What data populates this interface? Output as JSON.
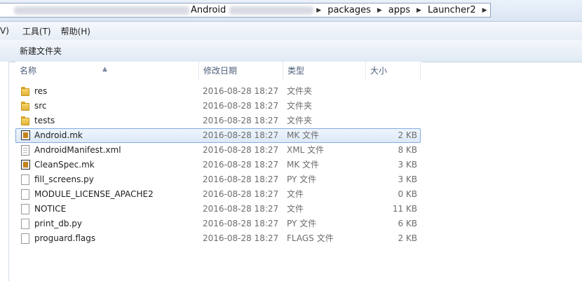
{
  "addressbar": {
    "crumbs": [
      "Android",
      "packages",
      "apps",
      "Launcher2"
    ]
  },
  "menubar": {
    "items": [
      "V)",
      "工具(T)",
      "帮助(H)"
    ]
  },
  "toolbar": {
    "new_folder_label": "新建文件夹"
  },
  "columns": {
    "name": "名称",
    "date": "修改日期",
    "type": "类型",
    "size": "大小"
  },
  "files": [
    {
      "name": "res",
      "date": "2016-08-28 18:27",
      "type": "文件夹",
      "size": "",
      "icon": "folder-icon"
    },
    {
      "name": "src",
      "date": "2016-08-28 18:27",
      "type": "文件夹",
      "size": "",
      "icon": "folder-icon"
    },
    {
      "name": "tests",
      "date": "2016-08-28 18:27",
      "type": "文件夹",
      "size": "",
      "icon": "folder-icon"
    },
    {
      "name": "Android.mk",
      "date": "2016-08-28 18:27",
      "type": "MK 文件",
      "size": "2 KB",
      "icon": "mk-file-icon",
      "selected": true
    },
    {
      "name": "AndroidManifest.xml",
      "date": "2016-08-28 18:27",
      "type": "XML 文件",
      "size": "8 KB",
      "icon": "document-icon"
    },
    {
      "name": "CleanSpec.mk",
      "date": "2016-08-28 18:27",
      "type": "MK 文件",
      "size": "3 KB",
      "icon": "mk-file-icon"
    },
    {
      "name": "fill_screens.py",
      "date": "2016-08-28 18:27",
      "type": "PY 文件",
      "size": "3 KB",
      "icon": "blank-file-icon"
    },
    {
      "name": "MODULE_LICENSE_APACHE2",
      "date": "2016-08-28 18:27",
      "type": "文件",
      "size": "0 KB",
      "icon": "blank-file-icon"
    },
    {
      "name": "NOTICE",
      "date": "2016-08-28 18:27",
      "type": "文件",
      "size": "11 KB",
      "icon": "blank-file-icon"
    },
    {
      "name": "print_db.py",
      "date": "2016-08-28 18:27",
      "type": "PY 文件",
      "size": "6 KB",
      "icon": "blank-file-icon"
    },
    {
      "name": "proguard.flags",
      "date": "2016-08-28 18:27",
      "type": "FLAGS 文件",
      "size": "2 KB",
      "icon": "blank-file-icon"
    }
  ]
}
